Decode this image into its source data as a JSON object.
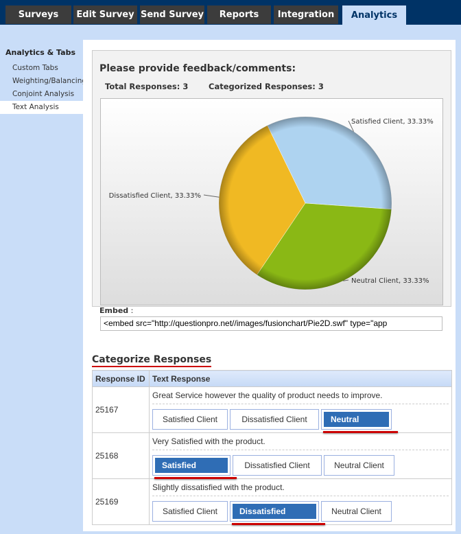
{
  "nav": {
    "tabs": [
      {
        "label": "Surveys"
      },
      {
        "label": "Edit Survey"
      },
      {
        "label": "Send Survey"
      },
      {
        "label": "Reports"
      },
      {
        "label": "Integration"
      },
      {
        "label": "Analytics",
        "active": true
      }
    ]
  },
  "sidebar": {
    "heading": "Analytics & Tabs",
    "items": [
      {
        "label": "Custom Tabs"
      },
      {
        "label": "Weighting/Balancing"
      },
      {
        "label": "Conjoint Analysis"
      },
      {
        "label": "Text Analysis",
        "active": true
      }
    ]
  },
  "main": {
    "question": "Please provide feedback/comments:",
    "total_responses": "Total Responses: 3",
    "categorized_responses": "Categorized Responses: 3",
    "embed_label": "Embed",
    "embed_colon": " :",
    "embed_value": "<embed src=\"http://questionpro.net//images/fusionchart/Pie2D.swf\"  type=\"app"
  },
  "chart_data": {
    "type": "pie",
    "slices": [
      {
        "label": "Satisfied Client, 33.33%",
        "name": "Satisfied Client",
        "value": 33.33,
        "color": "#aed3f0"
      },
      {
        "label": "Neutral Client, 33.33%",
        "name": "Neutral Client",
        "value": 33.33,
        "color": "#8ab815"
      },
      {
        "label": "Dissatisfied Client, 33.33%",
        "name": "Dissatisfied Client",
        "value": 33.33,
        "color": "#f0b923"
      }
    ]
  },
  "categorize": {
    "heading": "Categorize Responses",
    "columns": [
      "Response ID",
      "Text Response"
    ],
    "options": [
      "Satisfied Client",
      "Dissatisfied Client",
      "Neutral Client"
    ],
    "rows": [
      {
        "id": "25167",
        "text": "Great Service however the quality of product needs to improve.",
        "selected": 2
      },
      {
        "id": "25168",
        "text": "Very Satisfied with the product.",
        "selected": 0
      },
      {
        "id": "25169",
        "text": "Slightly dissatisfied with the product.",
        "selected": 1
      }
    ]
  },
  "colors": {
    "nav_bg": "#003366",
    "tab_bg": "#3c3c3c",
    "active_tab": "#c9ddf8",
    "selected_button": "#2f6db5",
    "underline": "#cc0000"
  }
}
